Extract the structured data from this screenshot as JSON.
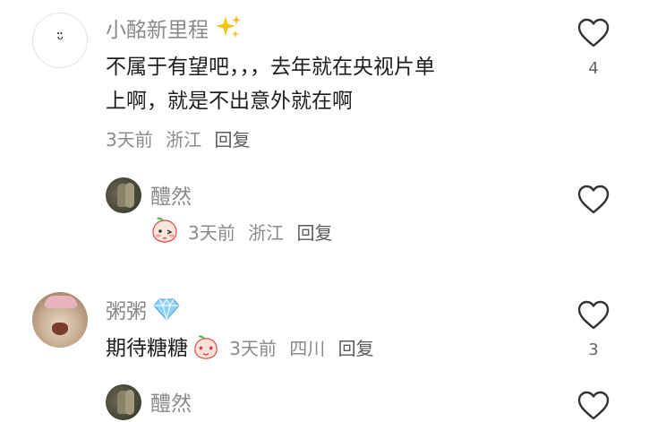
{
  "comments": [
    {
      "username": "小酩新里程",
      "avatar_face": "ᵕ̈",
      "text_line1": "不属于有望吧，，，去年就在央视片单",
      "text_line2": "上啊，就是不出意外就在啊",
      "time": "3天前",
      "location": "浙江",
      "reply": "回复",
      "likes": "4",
      "badge_icon": "sparkles-icon",
      "replies": [
        {
          "username": "醴然",
          "time": "3天前",
          "location": "浙江",
          "reply": "回复",
          "sticker_icon": "peach-emoji-icon"
        }
      ]
    },
    {
      "username": "粥粥",
      "badge_icon": "diamond-icon",
      "text": "期待糖糖",
      "time": "3天前",
      "location": "四川",
      "reply": "回复",
      "likes": "3",
      "replies": [
        {
          "username": "醴然"
        }
      ]
    }
  ],
  "colors": {
    "username": "#8a8a8a",
    "text": "#1f1f1f",
    "meta": "#8a8a8a",
    "heart_stroke": "#333333"
  }
}
